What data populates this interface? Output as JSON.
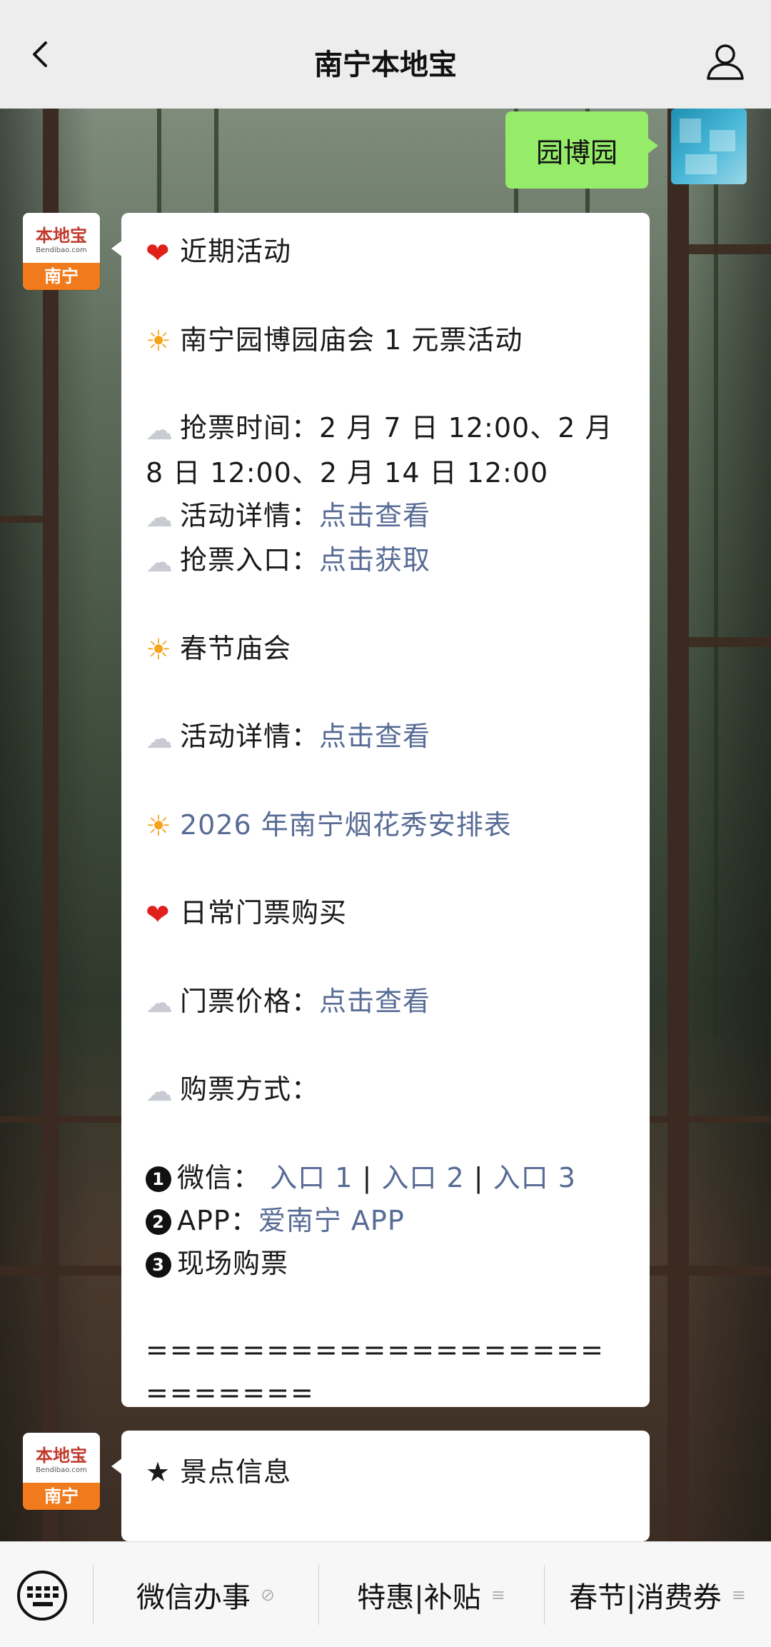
{
  "header": {
    "title": "南宁本地宝"
  },
  "sent_message": "园博园",
  "bot": {
    "logo": "本地宝",
    "domain": "Bendibao.com",
    "city": "南宁"
  },
  "message1": {
    "recent_heading": "近期活动",
    "event1_title": "南宁园博园庙会 1 元票活动",
    "grab_time_label": "抢票时间：",
    "grab_time_value": "2 月 7 日 12:00、2 月 8 日 12:00、2 月 14 日 12:00",
    "detail_label": "活动详情：",
    "detail_link": "点击查看",
    "entry_label": "抢票入口：",
    "entry_link": "点击获取",
    "event2_title": "春节庙会",
    "event2_detail_label": "活动详情：",
    "event2_detail_link": "点击查看",
    "fireworks_link": "2026 年南宁烟花秀安排表",
    "daily_heading": "日常门票购买",
    "price_label": "门票价格：",
    "price_link": "点击查看",
    "buy_label": "购票方式：",
    "wechat_label": "微信：",
    "wechat_links": [
      "入口 1",
      "入口 2",
      "入口 3"
    ],
    "wechat_sep": "|",
    "app_label": "APP：",
    "app_link": "爱南宁 APP",
    "onsite": "现场购票",
    "divider": "=========================="
  },
  "message2": {
    "heading": "★ 景点信息"
  },
  "bottom_menu": {
    "item1": "微信办事",
    "item2": "特惠|补贴",
    "item3": "春节|消费券",
    "link_mark": "⊘",
    "menu_mark": "≡"
  }
}
